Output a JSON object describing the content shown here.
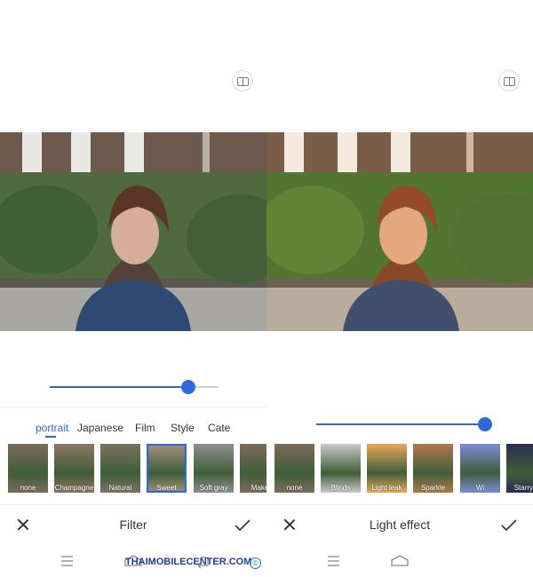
{
  "left": {
    "slider": {
      "value": 0.82
    },
    "tabs": [
      "portrait",
      "Japanese",
      "Film",
      "Style",
      "Cate"
    ],
    "active_tab": "portrait",
    "thumbs": [
      {
        "label": "none",
        "tone": "#7d6a5c"
      },
      {
        "label": "Champagne",
        "tone": "#8e7660"
      },
      {
        "label": "Natural",
        "tone": "#7a7360"
      },
      {
        "label": "Sweet",
        "tone": "#a5907f",
        "selected": true
      },
      {
        "label": "Soft gray",
        "tone": "#8f8f8f"
      },
      {
        "label": "Make",
        "tone": "#7d6a5c"
      }
    ],
    "title": "Filter"
  },
  "right": {
    "slider": {
      "value": 1.0
    },
    "thumbs": [
      {
        "label": "none",
        "tone": "#7d6a5c"
      },
      {
        "label": "Blinds",
        "tone": "#c9c9c9"
      },
      {
        "label": "Light leak",
        "tone": "#e8a85a"
      },
      {
        "label": "Sparkle",
        "tone": "#b1784e"
      },
      {
        "label": "Wi",
        "tone": "#7c8bd9"
      },
      {
        "label": "Starry c",
        "tone": "#2d2b52"
      }
    ],
    "title": "Light effect"
  },
  "watermark": {
    "text": "THAIMOBILECENTER.COM",
    "symbol": "©"
  },
  "colors": {
    "accent": "#2f68d9",
    "text": "#333333"
  }
}
